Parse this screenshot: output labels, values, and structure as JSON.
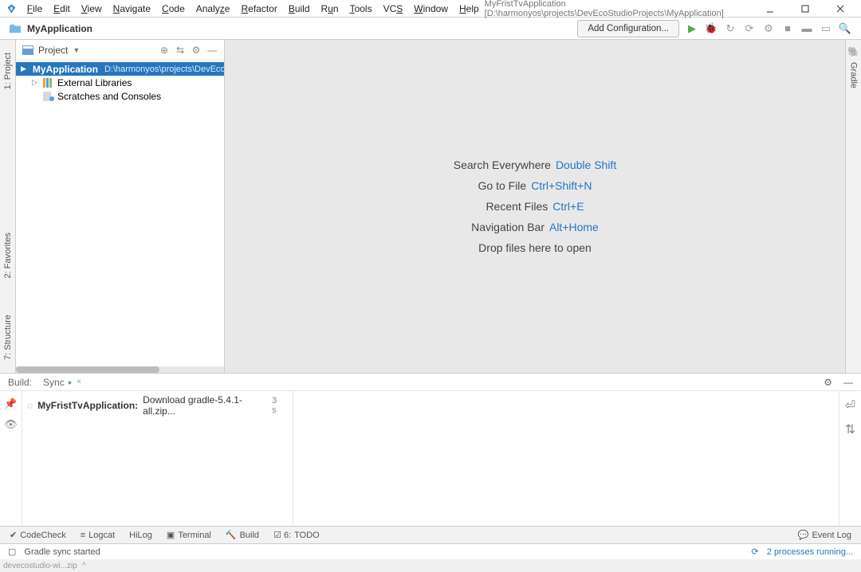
{
  "menubar": {
    "items": [
      "File",
      "Edit",
      "View",
      "Navigate",
      "Code",
      "Analyze",
      "Refactor",
      "Build",
      "Run",
      "Tools",
      "VCS",
      "Window",
      "Help"
    ],
    "title": "MyFristTvApplication [D:\\harmonyos\\projects\\DevEcoStudioProjects\\MyApplication]"
  },
  "toolbar": {
    "breadcrumb": "MyApplication",
    "add_config": "Add Configuration..."
  },
  "project_panel": {
    "title": "Project",
    "root": {
      "label": "MyApplication",
      "path": "D:\\harmonyos\\projects\\DevEcoStudioProjects\\MyApplication"
    },
    "external": "External Libraries",
    "scratches": "Scratches and Consoles"
  },
  "editor_hints": [
    {
      "label": "Search Everywhere",
      "shortcut": "Double Shift"
    },
    {
      "label": "Go to File",
      "shortcut": "Ctrl+Shift+N"
    },
    {
      "label": "Recent Files",
      "shortcut": "Ctrl+E"
    },
    {
      "label": "Navigation Bar",
      "shortcut": "Alt+Home"
    },
    {
      "label": "Drop files here to open",
      "shortcut": ""
    }
  ],
  "build": {
    "label": "Build:",
    "tab": "Sync",
    "task_name": "MyFristTvApplication:",
    "task_desc": "Download gradle-5.4.1-all.zip...",
    "time": "3 s"
  },
  "bottom_tabs": {
    "codecheck": "CodeCheck",
    "logcat": "Logcat",
    "hilog": "HiLog",
    "terminal": "Terminal",
    "build": "Build",
    "todo": "TODO",
    "event": "Event Log"
  },
  "status": {
    "msg": "Gradle sync started",
    "procs": "2 processes running..."
  },
  "left_gutter": {
    "project": "1: Project",
    "fav": "2: Favorites",
    "struct": "7: Structure"
  },
  "right_gutter": {
    "gradle": "Gradle"
  },
  "trunc": "devecostudio-wi...zip"
}
